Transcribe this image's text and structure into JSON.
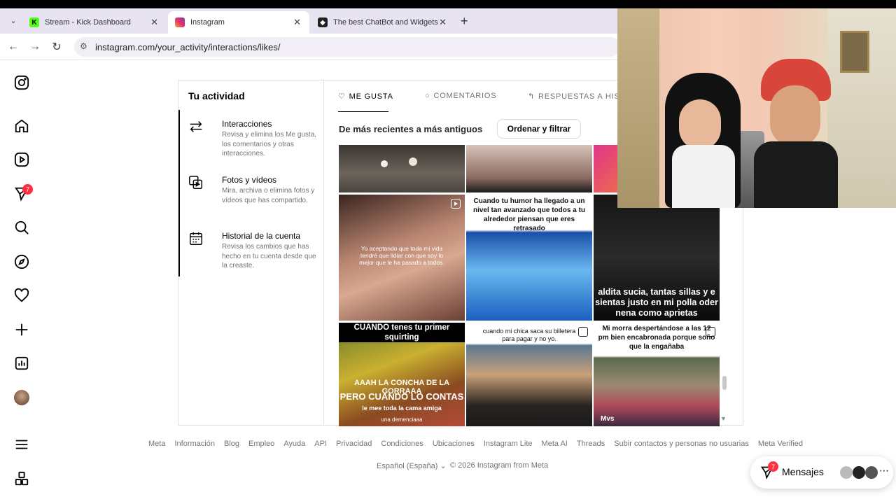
{
  "browser": {
    "tabs": [
      {
        "label": "Stream - Kick Dashboard",
        "active": false,
        "favicon": "kick-icon"
      },
      {
        "label": "Instagram",
        "active": true,
        "favicon": "instagram-icon"
      },
      {
        "label": "The best ChatBot and Widgets f",
        "active": false,
        "favicon": "streamelements-icon"
      }
    ],
    "new_tab": "+",
    "url": "instagram.com/your_activity/interactions/likes/"
  },
  "nav": {
    "notification_count": "7"
  },
  "activity": {
    "title": "Tu actividad",
    "items": [
      {
        "title": "Interacciones",
        "desc": "Revisa y elimina los Me gusta, los comentarios y otras interacciones."
      },
      {
        "title": "Fotos y vídeos",
        "desc": "Mira, archiva o elimina fotos y vídeos que has compartido."
      },
      {
        "title": "Historial de la cuenta",
        "desc": "Revisa los cambios que has hecho en tu cuenta desde que la creaste."
      }
    ],
    "tabs": [
      "ME GUSTA",
      "COMENTARIOS",
      "RESPUESTAS A HISTO"
    ],
    "sort_label": "De más recientes a más antiguos",
    "sort_button": "Ordenar y filtrar",
    "grid_captions": {
      "t4": "Yo aceptando que toda mi vida tendré que lidiar con que soy lo mejor que le ha pasado a todos.",
      "t5": "Cuando tu humor ha llegado a un nivel tan avanzado que todos a tu alrededor piensan que eres retrasado",
      "t6": "aldita sucia, tantas sillas y e sientas justo en mi polla oder nena como aprietas",
      "t7a": "CUANDO tenes tu primer squirting",
      "t7b": "AAAH LA CONCHA DE LA GORRAAA",
      "t7c": "PERO CUANDO LO CONTAS",
      "t7d": "le mee toda la cama amiga",
      "t7e": "una demenciaaa",
      "t8": "cuando mi chica saca su billetera para pagar y no yo.",
      "t9": "Mi morra despertándose a las 12 pm bien encabronada porque soño que la engañaba",
      "t9b": "Mvs"
    }
  },
  "footer": {
    "links": [
      "Meta",
      "Información",
      "Blog",
      "Empleo",
      "Ayuda",
      "API",
      "Privacidad",
      "Condiciones",
      "Ubicaciones",
      "Instagram Lite",
      "Meta AI",
      "Threads",
      "Subir contactos y personas no usuarias",
      "Meta Verified"
    ],
    "language": "Español (España)",
    "copyright": "© 2026 Instagram from Meta"
  },
  "messages": {
    "label": "Mensajes",
    "count": "7"
  }
}
